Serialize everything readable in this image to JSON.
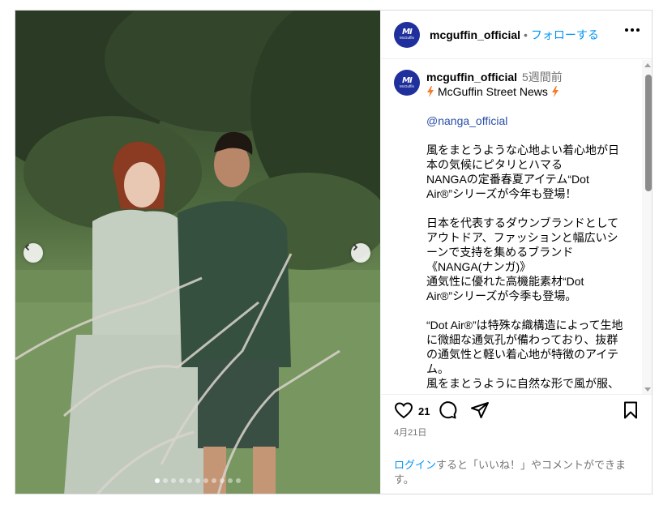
{
  "post": {
    "username": "mcguffin_official",
    "separator": "•",
    "follow_label": "フォローする",
    "avatar": {
      "mark": "MI",
      "brand": "McGuffin",
      "color": "#1f2f9c"
    },
    "more_icon": "more-horizontal-icon"
  },
  "caption": {
    "username": "mcguffin_official",
    "time_ago": "5週間前",
    "title": "McGuffin Street News",
    "mention": "@nanga_official",
    "paragraph1": [
      "風をまとうような心地よい着心地が日",
      "本の気候にピタリとハマる",
      "NANGAの定番春夏アイテム“Dot",
      "Air®”シリーズが今年も登場！"
    ],
    "paragraph2": [
      "日本を代表するダウンブランドとして",
      "アウトドア、ファッションと幅広いシ",
      "ーンで支持を集めるブランド",
      "《NANGA(ナンガ)》",
      "通気性に優れた高機能素材“Dot",
      "Air®”シリーズが今季も登場。"
    ],
    "paragraph3": [
      "“Dot Air®”は特殊な織構造によって生地",
      "に微細な通気孔が備わっており、抜群",
      "の通気性と軽い着心地が特徴のアイテ",
      "ム。",
      "風をまとうように自然な形で風が服、"
    ]
  },
  "actions": {
    "like_count": "21",
    "date": "4月21日",
    "icons": [
      "heart-icon",
      "comment-icon",
      "share-icon",
      "bookmark-icon"
    ]
  },
  "login_prompt": {
    "link": "ログイン",
    "text": "すると「いいね！」やコメントができます。"
  },
  "carousel": {
    "total": 11,
    "active": 1
  },
  "colors": {
    "accent": "#0095f6",
    "mention": "#2b4fa7",
    "muted": "#737373"
  }
}
